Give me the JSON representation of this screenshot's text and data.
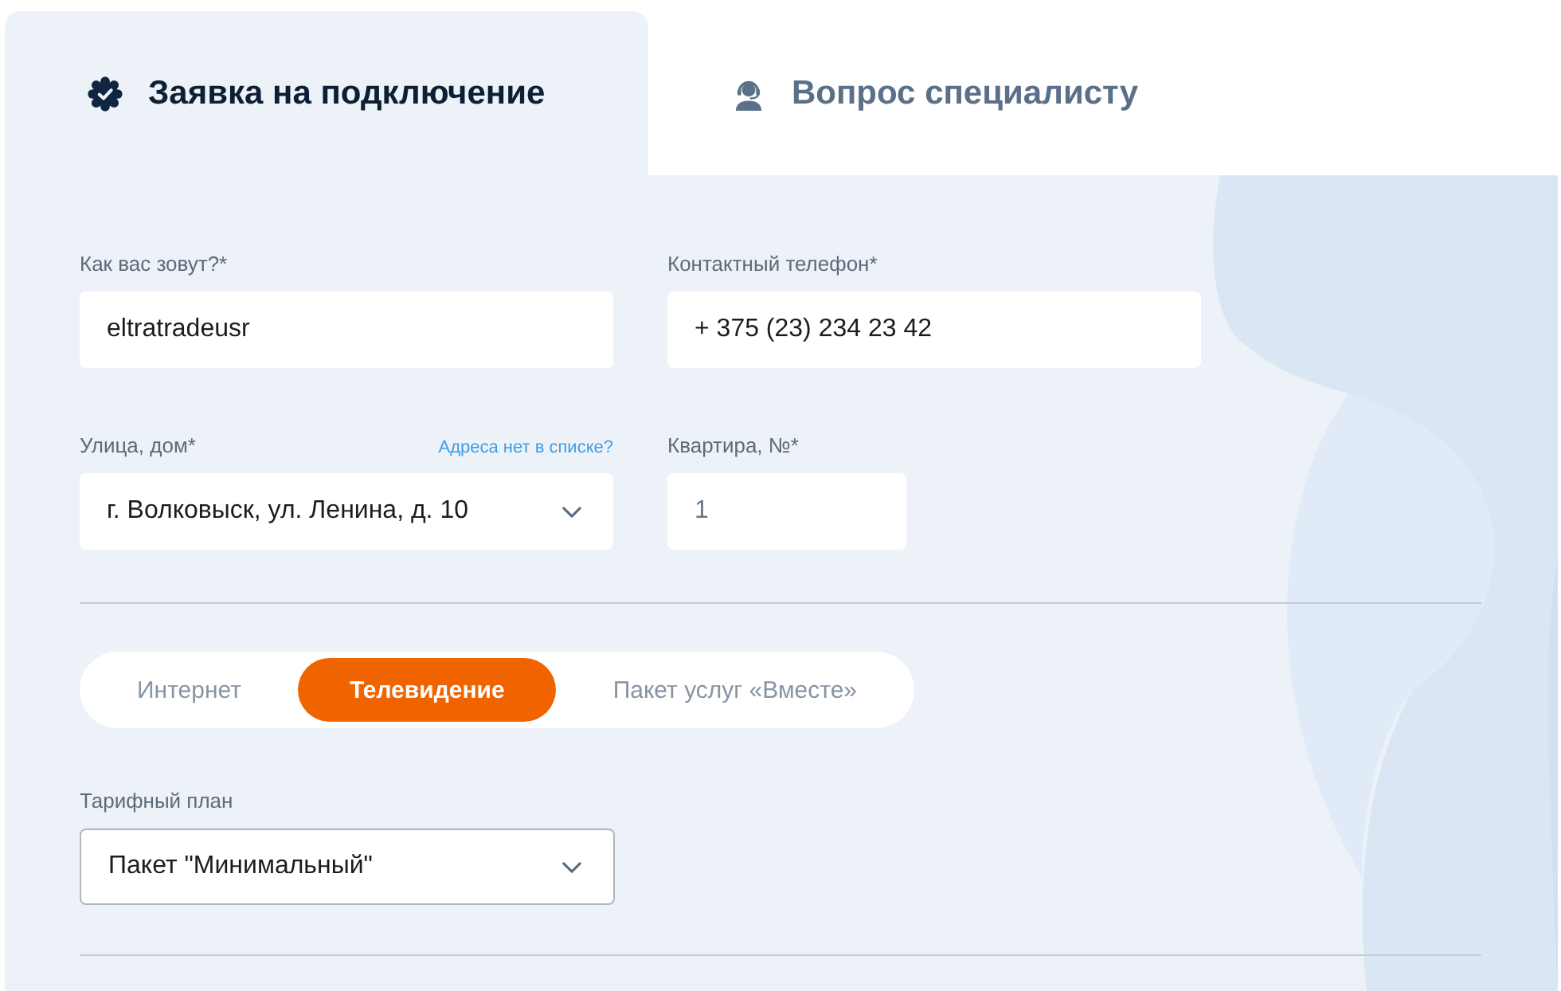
{
  "tabs": [
    {
      "label": "Заявка на подключение",
      "selected": true
    },
    {
      "label": "Вопрос специалисту",
      "selected": false
    }
  ],
  "fields": [
    {
      "kind": "text",
      "label": "Как вас зовут?*",
      "value": "eltratradeusr"
    },
    {
      "kind": "text",
      "label": "Контактный телефон*",
      "value": "+ 375 (23) 234 23 42"
    },
    {
      "kind": "select",
      "label": "Улица, дом*",
      "link": "Адреса нет в списке?",
      "value": "г. Волковыск, ул. Ленина, д. 10"
    },
    {
      "kind": "short",
      "label": "Квартира, №*",
      "placeholder": "1"
    }
  ],
  "service_tabs": [
    {
      "label": "Интернет",
      "selected": false
    },
    {
      "label": "Телевидение",
      "selected": true
    },
    {
      "label": "Пакет услуг «Вместе»",
      "selected": false
    }
  ],
  "tariff": {
    "label": "Тарифный план",
    "value": "Пакет \"Минимальный\""
  }
}
